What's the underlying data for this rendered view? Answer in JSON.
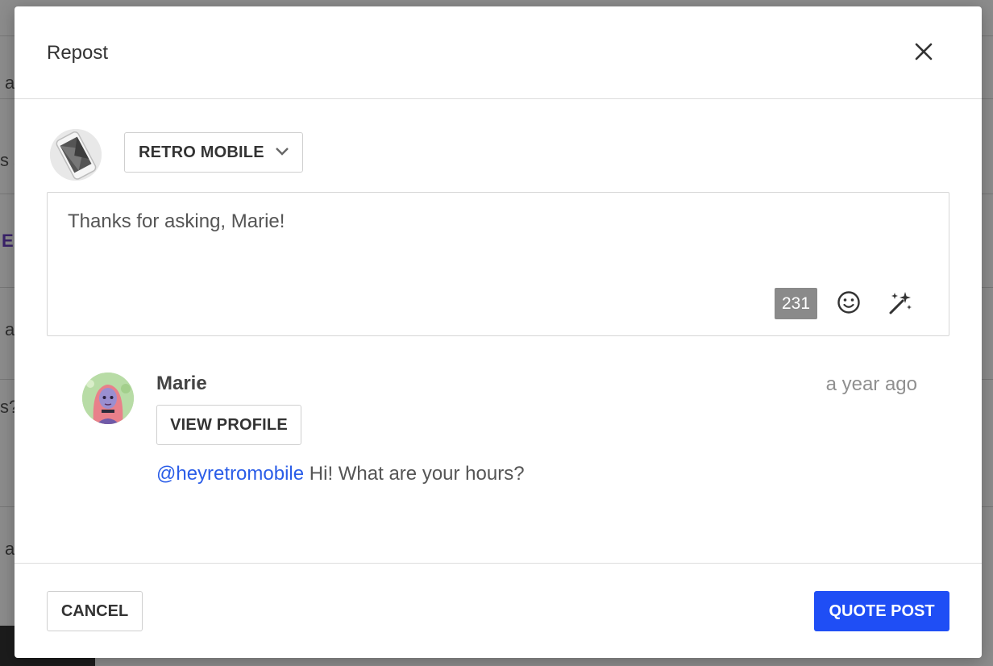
{
  "background": {
    "fragments": [
      "a",
      "s s",
      "E",
      "a",
      "s?",
      "a"
    ]
  },
  "modal": {
    "title": "Repost",
    "close_icon": "close-icon"
  },
  "account": {
    "name": "RETRO MOBILE",
    "chevron_icon": "chevron-down-icon"
  },
  "composer": {
    "value": "Thanks for asking, Marie!",
    "char_count": "231",
    "emoji_icon": "emoji-icon",
    "magic_icon": "magic-wand-icon"
  },
  "quoted_post": {
    "author": "Marie",
    "time": "a year ago",
    "view_profile_label": "VIEW PROFILE",
    "mention": "@heyretromobile",
    "text": " Hi! What are your hours?"
  },
  "footer": {
    "cancel_label": "CANCEL",
    "submit_label": "QUOTE POST"
  },
  "colors": {
    "primary": "#1f4ef5",
    "mention": "#2a5de8",
    "counter_bg": "#8a8a8a"
  }
}
